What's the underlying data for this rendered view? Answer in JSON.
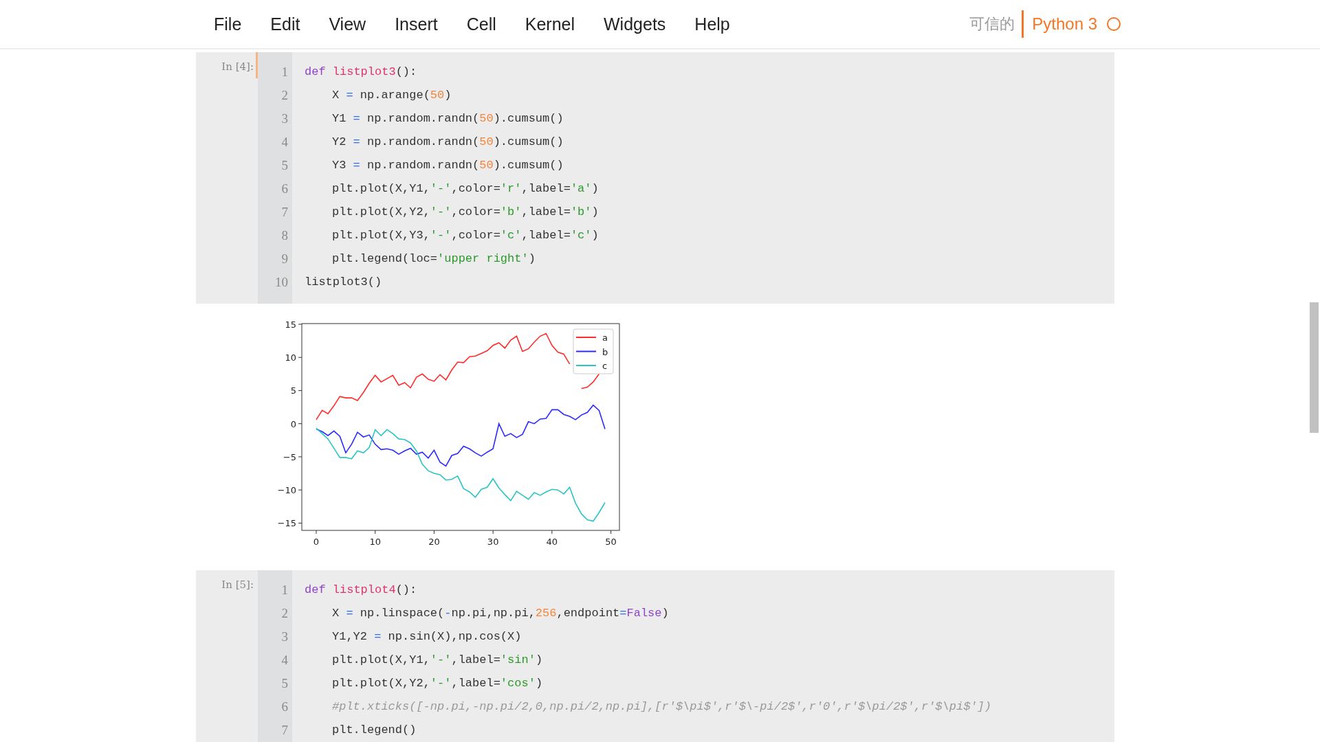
{
  "menu": {
    "items": [
      "File",
      "Edit",
      "View",
      "Insert",
      "Cell",
      "Kernel",
      "Widgets",
      "Help"
    ],
    "trusted": "可信的",
    "kernel": "Python 3",
    "kernel_busy": false
  },
  "cells": [
    {
      "prompt": "In [4]:",
      "selected": true,
      "lines": [
        {
          "number": "1",
          "indented": false,
          "tokens": [
            {
              "text": "def ",
              "kind": "keyword"
            },
            {
              "text": "listplot3",
              "kind": "defname"
            },
            {
              "text": "():",
              "kind": "plain"
            }
          ]
        },
        {
          "number": "2",
          "indented": true,
          "tokens": [
            {
              "text": "X ",
              "kind": "plain"
            },
            {
              "text": "=",
              "kind": "op"
            },
            {
              "text": " np.arange(",
              "kind": "plain"
            },
            {
              "text": "50",
              "kind": "number"
            },
            {
              "text": ")",
              "kind": "plain"
            }
          ]
        },
        {
          "number": "3",
          "indented": true,
          "tokens": [
            {
              "text": "Y1 ",
              "kind": "plain"
            },
            {
              "text": "=",
              "kind": "op"
            },
            {
              "text": " np.random.randn(",
              "kind": "plain"
            },
            {
              "text": "50",
              "kind": "number"
            },
            {
              "text": ").cumsum()",
              "kind": "plain"
            }
          ]
        },
        {
          "number": "4",
          "indented": true,
          "tokens": [
            {
              "text": "Y2 ",
              "kind": "plain"
            },
            {
              "text": "=",
              "kind": "op"
            },
            {
              "text": " np.random.randn(",
              "kind": "plain"
            },
            {
              "text": "50",
              "kind": "number"
            },
            {
              "text": ").cumsum()",
              "kind": "plain"
            }
          ]
        },
        {
          "number": "5",
          "indented": true,
          "tokens": [
            {
              "text": "Y3 ",
              "kind": "plain"
            },
            {
              "text": "=",
              "kind": "op"
            },
            {
              "text": " np.random.randn(",
              "kind": "plain"
            },
            {
              "text": "50",
              "kind": "number"
            },
            {
              "text": ").cumsum()",
              "kind": "plain"
            }
          ]
        },
        {
          "number": "6",
          "indented": true,
          "tokens": [
            {
              "text": "plt.plot(X,Y1,",
              "kind": "plain"
            },
            {
              "text": "'-'",
              "kind": "string"
            },
            {
              "text": ",color=",
              "kind": "plain"
            },
            {
              "text": "'r'",
              "kind": "string"
            },
            {
              "text": ",label=",
              "kind": "plain"
            },
            {
              "text": "'a'",
              "kind": "string"
            },
            {
              "text": ")",
              "kind": "plain"
            }
          ]
        },
        {
          "number": "7",
          "indented": true,
          "tokens": [
            {
              "text": "plt.plot(X,Y2,",
              "kind": "plain"
            },
            {
              "text": "'-'",
              "kind": "string"
            },
            {
              "text": ",color=",
              "kind": "plain"
            },
            {
              "text": "'b'",
              "kind": "string"
            },
            {
              "text": ",label=",
              "kind": "plain"
            },
            {
              "text": "'b'",
              "kind": "string"
            },
            {
              "text": ")",
              "kind": "plain"
            }
          ]
        },
        {
          "number": "8",
          "indented": true,
          "tokens": [
            {
              "text": "plt.plot(X,Y3,",
              "kind": "plain"
            },
            {
              "text": "'-'",
              "kind": "string"
            },
            {
              "text": ",color=",
              "kind": "plain"
            },
            {
              "text": "'c'",
              "kind": "string"
            },
            {
              "text": ",label=",
              "kind": "plain"
            },
            {
              "text": "'c'",
              "kind": "string"
            },
            {
              "text": ")",
              "kind": "plain"
            }
          ]
        },
        {
          "number": "9",
          "indented": true,
          "tokens": [
            {
              "text": "plt.legend(loc=",
              "kind": "plain"
            },
            {
              "text": "'upper right'",
              "kind": "string"
            },
            {
              "text": ")",
              "kind": "plain"
            }
          ]
        },
        {
          "number": "10",
          "indented": false,
          "tokens": [
            {
              "text": "listplot3()",
              "kind": "plain"
            }
          ]
        }
      ],
      "output": {
        "chart_data": {
          "type": "line",
          "x": [
            0,
            1,
            2,
            3,
            4,
            5,
            6,
            7,
            8,
            9,
            10,
            11,
            12,
            13,
            14,
            15,
            16,
            17,
            18,
            19,
            20,
            21,
            22,
            23,
            24,
            25,
            26,
            27,
            28,
            29,
            30,
            31,
            32,
            33,
            34,
            35,
            36,
            37,
            38,
            39,
            40,
            41,
            42,
            43,
            44,
            45,
            46,
            47,
            48,
            49
          ],
          "series": [
            {
              "name": "a",
              "color": "#ff2a2a",
              "values": [
                0.6,
                2.0,
                1.5,
                2.7,
                4.1,
                3.9,
                3.9,
                3.5,
                4.7,
                6.1,
                7.3,
                6.3,
                6.8,
                7.3,
                5.8,
                6.2,
                5.4,
                7.0,
                7.5,
                6.7,
                6.4,
                7.4,
                6.6,
                8.1,
                9.3,
                9.2,
                10.1,
                10.2,
                10.6,
                11.0,
                11.8,
                12.2,
                11.4,
                12.6,
                13.2,
                10.9,
                11.3,
                12.3,
                13.2,
                13.6,
                11.8,
                10.8,
                10.5,
                9.0,
                null,
                5.3,
                5.5,
                6.3,
                7.5,
                null
              ]
            },
            {
              "name": "b",
              "color": "#2a2aff",
              "values": [
                -0.8,
                -1.2,
                -1.8,
                -1.1,
                -1.9,
                -4.4,
                -3.1,
                -1.3,
                -2.0,
                -1.7,
                -3.1,
                -3.9,
                -3.8,
                -4.0,
                -4.6,
                -4.1,
                -3.7,
                -4.6,
                -4.3,
                -5.2,
                -4.0,
                -5.8,
                -6.4,
                -4.8,
                -4.5,
                -3.4,
                -3.8,
                -4.4,
                -4.9,
                -4.3,
                -3.8,
                0.0,
                -1.9,
                -1.5,
                -2.1,
                -1.6,
                0.3,
                0.0,
                0.7,
                0.8,
                2.1,
                2.1,
                1.4,
                1.1,
                0.6,
                1.3,
                1.7,
                2.8,
                2.0,
                -0.8
              ]
            },
            {
              "name": "c",
              "color": "#2ac4c4",
              "values": [
                -0.7,
                -1.5,
                -2.3,
                -3.7,
                -5.1,
                -5.1,
                -5.3,
                -4.1,
                -4.4,
                -3.6,
                -0.9,
                -1.8,
                -0.9,
                -1.5,
                -2.3,
                -2.4,
                -2.9,
                -4.1,
                -6.1,
                -7.1,
                -7.5,
                -7.7,
                -8.5,
                -8.4,
                -7.9,
                -9.8,
                -10.3,
                -11.1,
                -9.9,
                -9.6,
                -8.3,
                -9.7,
                -10.7,
                -11.6,
                -10.2,
                -10.8,
                -11.4,
                -10.4,
                -10.8,
                -10.3,
                -9.9,
                -10.0,
                -10.6,
                -9.6,
                -12.0,
                -13.6,
                -14.5,
                -14.7,
                -13.4,
                -11.9
              ]
            }
          ],
          "legend": true,
          "xlim": [
            -2.45,
            51.45
          ],
          "ylim": [
            -16.1,
            15.1
          ],
          "xticks": [
            0,
            10,
            20,
            30,
            40,
            50
          ],
          "yticks": [
            {
              "value": 15,
              "label": "15"
            },
            {
              "value": 10,
              "label": "10"
            },
            {
              "value": 5,
              "label": "5"
            },
            {
              "value": 0,
              "label": "0"
            },
            {
              "value": -5,
              "label": "−5"
            },
            {
              "value": -10,
              "label": "−10"
            },
            {
              "value": -15,
              "label": "−15"
            }
          ]
        }
      }
    },
    {
      "prompt": "In [5]:",
      "selected": false,
      "lines": [
        {
          "number": "1",
          "indented": false,
          "tokens": [
            {
              "text": "def ",
              "kind": "keyword"
            },
            {
              "text": "listplot4",
              "kind": "defname"
            },
            {
              "text": "():",
              "kind": "plain"
            }
          ]
        },
        {
          "number": "2",
          "indented": true,
          "tokens": [
            {
              "text": "X ",
              "kind": "plain"
            },
            {
              "text": "=",
              "kind": "op"
            },
            {
              "text": " np.linspace(",
              "kind": "plain"
            },
            {
              "text": "-",
              "kind": "op"
            },
            {
              "text": "np.pi,np.pi,",
              "kind": "plain"
            },
            {
              "text": "256",
              "kind": "number"
            },
            {
              "text": ",endpoint",
              "kind": "plain"
            },
            {
              "text": "=",
              "kind": "op"
            },
            {
              "text": "False",
              "kind": "keyword"
            },
            {
              "text": ")",
              "kind": "plain"
            }
          ]
        },
        {
          "number": "3",
          "indented": true,
          "tokens": [
            {
              "text": "Y1,Y2 ",
              "kind": "plain"
            },
            {
              "text": "=",
              "kind": "op"
            },
            {
              "text": " np.sin(X),np.cos(X)",
              "kind": "plain"
            }
          ]
        },
        {
          "number": "4",
          "indented": true,
          "tokens": [
            {
              "text": "plt.plot(X,Y1,",
              "kind": "plain"
            },
            {
              "text": "'-'",
              "kind": "string"
            },
            {
              "text": ",label=",
              "kind": "plain"
            },
            {
              "text": "'sin'",
              "kind": "string"
            },
            {
              "text": ")",
              "kind": "plain"
            }
          ]
        },
        {
          "number": "5",
          "indented": true,
          "tokens": [
            {
              "text": "plt.plot(X,Y2,",
              "kind": "plain"
            },
            {
              "text": "'-'",
              "kind": "string"
            },
            {
              "text": ",label=",
              "kind": "plain"
            },
            {
              "text": "'cos'",
              "kind": "string"
            },
            {
              "text": ")",
              "kind": "plain"
            }
          ]
        },
        {
          "number": "6",
          "indented": true,
          "tokens": [
            {
              "text": "#plt.xticks([-np.pi,-np.pi/2,0,np.pi/2,np.pi],[r'$\\pi$',r'$\\-pi/2$',r'0',r'$\\pi/2$',r'$\\pi$'])",
              "kind": "comment"
            }
          ]
        },
        {
          "number": "7",
          "indented": true,
          "tokens": [
            {
              "text": "plt.legend()",
              "kind": "plain"
            }
          ]
        }
      ]
    }
  ]
}
